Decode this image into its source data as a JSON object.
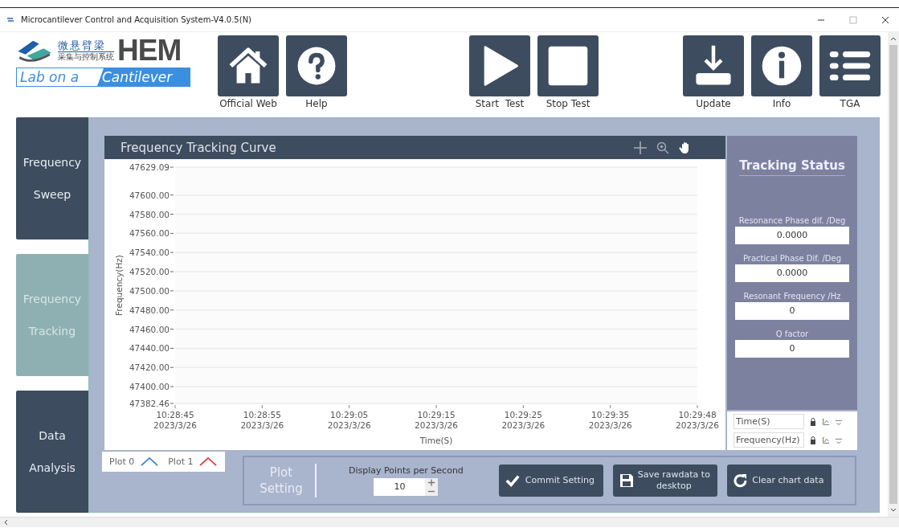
{
  "window": {
    "title": "Microcantilever Control and Acquisition System-V4.0.5(N)"
  },
  "logo": {
    "name_cn": "微悬臂梁",
    "subtitle_cn": "采集与控制系统",
    "brand": "HEM",
    "tagline_left": "Lab on a",
    "tagline_right": "Cantilever"
  },
  "toolbar_groups": [
    {
      "buttons": [
        {
          "label": "Official Web",
          "kind": "home"
        },
        {
          "label": "Help",
          "kind": "help"
        }
      ]
    },
    {
      "buttons": [
        {
          "label": "Start  Test",
          "kind": "start"
        },
        {
          "label": "Stop Test",
          "kind": "stop"
        }
      ]
    },
    {
      "buttons": [
        {
          "label": "Update",
          "kind": "download"
        },
        {
          "label": "Info",
          "kind": "info"
        },
        {
          "label": "TGA",
          "kind": "list"
        }
      ]
    }
  ],
  "nav": [
    {
      "label": "Frequency Sweep",
      "selected": false
    },
    {
      "label": "Frequency Tracking",
      "selected": true
    },
    {
      "label": "Data Analysis",
      "selected": false
    }
  ],
  "chart": {
    "title": "Frequency Tracking Curve",
    "chart_data": {
      "type": "line",
      "grid": true,
      "xlabel": "Time(S)",
      "ylabel": "Frequency(Hz)",
      "ylim": [
        47382.46,
        47629.09
      ],
      "categories": [
        "10:28:45\n2023/3/26",
        "10:28:55\n2023/3/26",
        "10:29:05\n2023/3/26",
        "10:29:15\n2023/3/26",
        "10:29:25\n2023/3/26",
        "10:29:35\n2023/3/26",
        "10:29:48\n2023/3/26"
      ],
      "yticks": [
        {
          "value": 47629.09,
          "label": "47629.09"
        },
        {
          "value": 47600,
          "label": "47600.00"
        },
        {
          "value": 47580,
          "label": "47580.00"
        },
        {
          "value": 47560,
          "label": "47560.00"
        },
        {
          "value": 47540,
          "label": "47540.00"
        },
        {
          "value": 47520,
          "label": "47520.00"
        },
        {
          "value": 47500,
          "label": "47500.00"
        },
        {
          "value": 47480,
          "label": "47480.00"
        },
        {
          "value": 47460,
          "label": "47460.00"
        },
        {
          "value": 47440,
          "label": "47440.00"
        },
        {
          "value": 47420,
          "label": "47420.00"
        },
        {
          "value": 47400,
          "label": "47400.00"
        },
        {
          "value": 47382.46,
          "label": "47382.46"
        }
      ]
    }
  },
  "legend": [
    {
      "name": "Plot 0",
      "color": "#3a86c8"
    },
    {
      "name": "Plot 1",
      "color": "#d9423a"
    }
  ],
  "axis_controls": [
    {
      "label": "Time(S)"
    },
    {
      "label": "Frequency(Hz)"
    }
  ],
  "status": {
    "title": "Tracking Status",
    "fields": [
      {
        "label": "Resonance Phase dif. /Deg",
        "value": "0.0000"
      },
      {
        "label": "Practical Phase Dif. /Deg",
        "value": "0.0000"
      },
      {
        "label": "Resonant Frequency /Hz",
        "value": "0"
      },
      {
        "label": "Q factor",
        "value": "0"
      }
    ]
  },
  "plot_setting": {
    "label": "Plot Setting",
    "points_label": "Display Points per Second",
    "points_value": "10"
  },
  "actions": [
    {
      "label": "Commit Setting",
      "kind": "check"
    },
    {
      "label": "Save rawdata to desktop",
      "kind": "save"
    },
    {
      "label": "Clear chart data",
      "kind": "refresh"
    }
  ]
}
